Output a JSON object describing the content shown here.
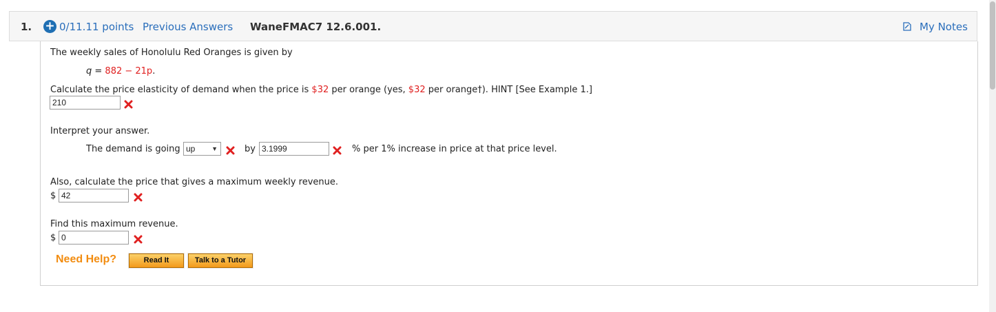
{
  "question": {
    "number": "1.",
    "points": "0/11.11 points",
    "previous_answers": "Previous Answers",
    "code": "WaneFMAC7 12.6.001.",
    "my_notes": "My Notes"
  },
  "problem": {
    "intro": "The weekly sales of Honolulu Red Oranges is given by",
    "equation_prefix": "q = ",
    "equation_value": "882 − 21p",
    "equation_suffix": ".",
    "q1_part1": "Calculate the price elasticity of demand when the price is ",
    "q1_price1": "$32",
    "q1_part2": " per orange (yes, ",
    "q1_price2": "$32",
    "q1_part3": " per orange†). HINT [See Example 1.]",
    "q1_answer": "210",
    "interpret_label": "Interpret your answer.",
    "demand_prefix": "The demand is going",
    "demand_select": "up",
    "by_label": "by",
    "by_answer": "3.1999",
    "percent_text": "% per 1% increase in price at that price level.",
    "q2_label": "Also, calculate the price that gives a maximum weekly revenue.",
    "q2_dollar": "$",
    "q2_answer": "42",
    "q3_label": "Find this maximum revenue.",
    "q3_dollar": "$",
    "q3_answer": "0"
  },
  "help": {
    "need_help": "Need Help?",
    "read_it": "Read It",
    "talk_tutor": "Talk to a Tutor"
  },
  "colors": {
    "link": "#2a6ebb",
    "incorrect": "#e02020",
    "help": "#f28c10"
  }
}
